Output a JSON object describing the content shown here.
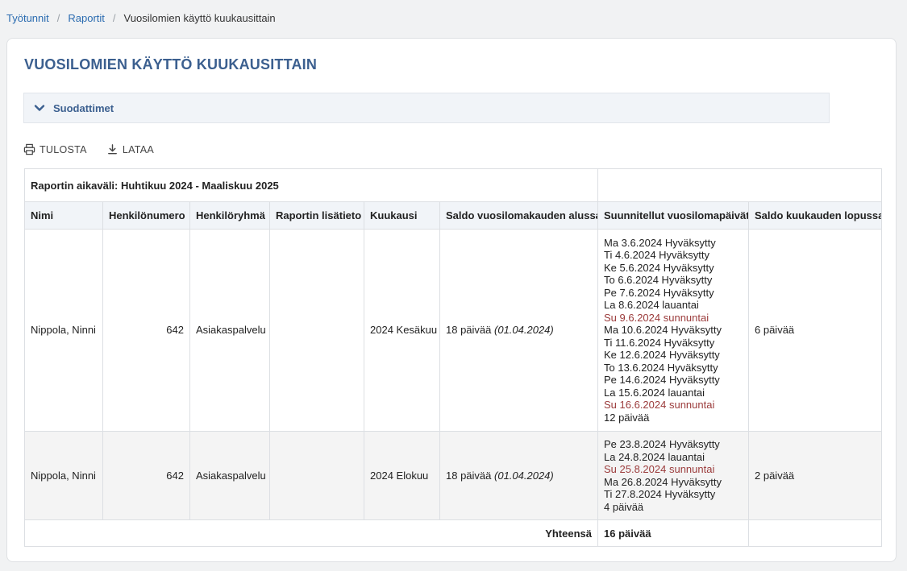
{
  "breadcrumb": {
    "items": [
      "Työtunnit",
      "Raportit"
    ],
    "current": "Vuosilomien käyttö kuukausittain"
  },
  "page": {
    "title": "VUOSILOMIEN KÄYTTÖ KUUKAUSITTAIN"
  },
  "filters": {
    "label": "Suodattimet"
  },
  "toolbar": {
    "print": "TULOSTA",
    "download": "LATAA"
  },
  "icons": {
    "filters_toggle": "chevron-down-icon",
    "print": "printer-icon",
    "download": "download-icon"
  },
  "colors": {
    "accent": "#3b5f8f",
    "link": "#2a6bb0",
    "sunday": "#9b3b3b"
  },
  "report": {
    "range_label": "Raportin aikaväli: Huhtikuu 2024 - Maaliskuu 2025",
    "columns": [
      "Nimi",
      "Henkilönumero",
      "Henkilöryhmä",
      "Raportin lisätieto",
      "Kuukausi",
      "Saldo vuosilomakauden alussa",
      "Suunnitellut vuosilomapäivät",
      "Saldo kuukauden lopussa"
    ],
    "rows": [
      {
        "name": "Nippola, Ninni",
        "number": "642",
        "group": "Asiakaspalvelu",
        "extra": "",
        "month": "2024 Kesäkuu",
        "start_balance": "18 päivää",
        "start_date": "(01.04.2024)",
        "days": [
          "Ma 3.6.2024 Hyväksytty",
          "Ti 4.6.2024 Hyväksytty",
          "Ke 5.6.2024 Hyväksytty",
          "To 6.6.2024 Hyväksytty",
          "Pe 7.6.2024 Hyväksytty",
          "La 8.6.2024 lauantai",
          "Su 9.6.2024 sunnuntai",
          "Ma 10.6.2024 Hyväksytty",
          "Ti 11.6.2024 Hyväksytty",
          "Ke 12.6.2024 Hyväksytty",
          "To 13.6.2024 Hyväksytty",
          "Pe 14.6.2024 Hyväksytty",
          "La 15.6.2024 lauantai",
          "Su 16.6.2024 sunnuntai",
          "12 päivää"
        ],
        "end_balance": "6 päivää"
      },
      {
        "name": "Nippola, Ninni",
        "number": "642",
        "group": "Asiakaspalvelu",
        "extra": "",
        "month": "2024 Elokuu",
        "start_balance": "18 päivää",
        "start_date": "(01.04.2024)",
        "days": [
          "Pe 23.8.2024 Hyväksytty",
          "La 24.8.2024 lauantai",
          "Su 25.8.2024 sunnuntai",
          "Ma 26.8.2024 Hyväksytty",
          "Ti 27.8.2024 Hyväksytty",
          "4 päivää"
        ],
        "end_balance": "2 päivää"
      }
    ],
    "total_label": "Yhteensä",
    "total_value": "16 päivää"
  }
}
